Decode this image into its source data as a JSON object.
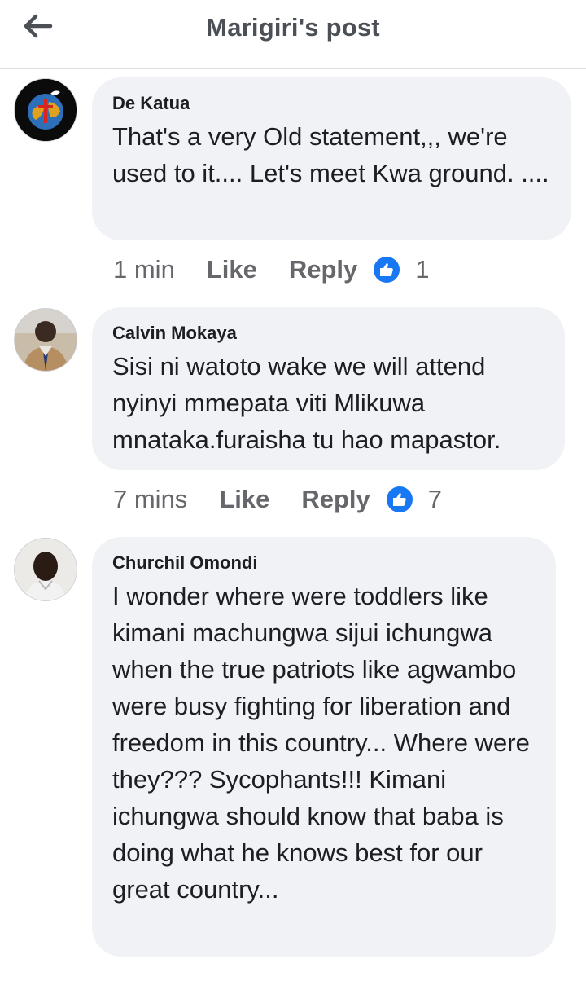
{
  "header": {
    "title": "Marigiri's post"
  },
  "comments": [
    {
      "author": "De Katua",
      "text": "That's a very Old statement,,, we're used to it.... Let's meet Kwa ground. ....",
      "time": "1 min",
      "like_label": "Like",
      "reply_label": "Reply",
      "like_count": "1"
    },
    {
      "author": "Calvin Mokaya",
      "text": "Sisi ni watoto wake we will attend nyinyi mmepata viti Mlikuwa mnataka.furaisha tu hao mapastor.",
      "time": "7 mins",
      "like_label": "Like",
      "reply_label": "Reply",
      "like_count": "7"
    },
    {
      "author": "Churchil Omondi",
      "text": "I wonder where were toddlers like kimani machungwa sijui ichungwa when the true patriots like agwambo were busy fighting for liberation and freedom in this country... Where were they??? Sycophants!!! Kimani ichungwa should know that baba is doing what he knows best for our great country...",
      "time": "",
      "like_label": "",
      "reply_label": "",
      "like_count": ""
    }
  ],
  "colors": {
    "like_blue": "#1877f2",
    "bubble_bg": "#f0f2f5",
    "meta_gray": "#65676b"
  }
}
